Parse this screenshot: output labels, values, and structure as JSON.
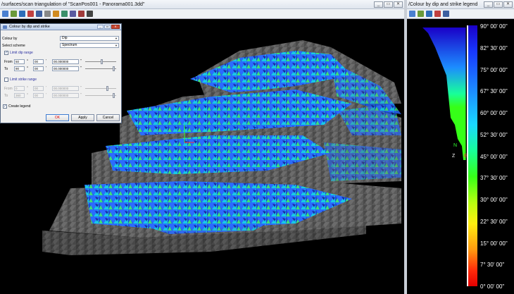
{
  "main_window": {
    "title": "/surfaces/scan triangulation of \"ScanPos001 - Panorama001.3dd\"",
    "controls": {
      "minimize": "_",
      "restore": "▭",
      "close": "✕"
    }
  },
  "legend_window": {
    "title": "/Colour by dip and strike legend",
    "controls": {
      "minimize": "_",
      "restore": "▭",
      "close": "✕"
    },
    "labels": [
      "90° 00' 00\"",
      "82° 30' 00\"",
      "75° 00' 00\"",
      "67° 30' 00\"",
      "60° 00' 00\"",
      "52° 30' 00\"",
      "45° 00' 00\"",
      "37° 30' 00\"",
      "30° 00' 00\"",
      "22° 30' 00\"",
      "15° 00' 00\"",
      "7° 30' 00\"",
      "0° 00' 00\""
    ],
    "axis": {
      "north": "N",
      "east": "E",
      "z": "Z"
    }
  },
  "dialog": {
    "title": "Colour by dip and strike",
    "colour_by_label": "Colour by",
    "colour_by_value": "Dip",
    "scheme_label": "Select scheme",
    "scheme_value": "Spectrum",
    "limit_dip": {
      "label": "Limit dip range",
      "checked": true,
      "from_label": "From",
      "from_deg": "50",
      "from_min": "00",
      "from_sec": "00.000000",
      "to_label": "To",
      "to_deg": "90",
      "to_min": "00",
      "to_sec": "00.000000"
    },
    "limit_strike": {
      "label": "Limit strike range",
      "checked": false,
      "from_label": "From",
      "from_deg": "0",
      "from_min": "00",
      "from_sec": "00.000000",
      "to_label": "To",
      "to_deg": "360",
      "to_min": "00",
      "to_sec": "00.000000"
    },
    "create_legend": {
      "label": "Create legend",
      "checked": true
    },
    "buttons": {
      "ok": "OK",
      "apply": "Apply",
      "cancel": "Cancel"
    },
    "units": {
      "deg": "°",
      "min": "'",
      "sec": "\""
    }
  },
  "colors": {
    "background": "#000000",
    "dip_high": "#1a00c8",
    "dip_low": "#e40000"
  }
}
